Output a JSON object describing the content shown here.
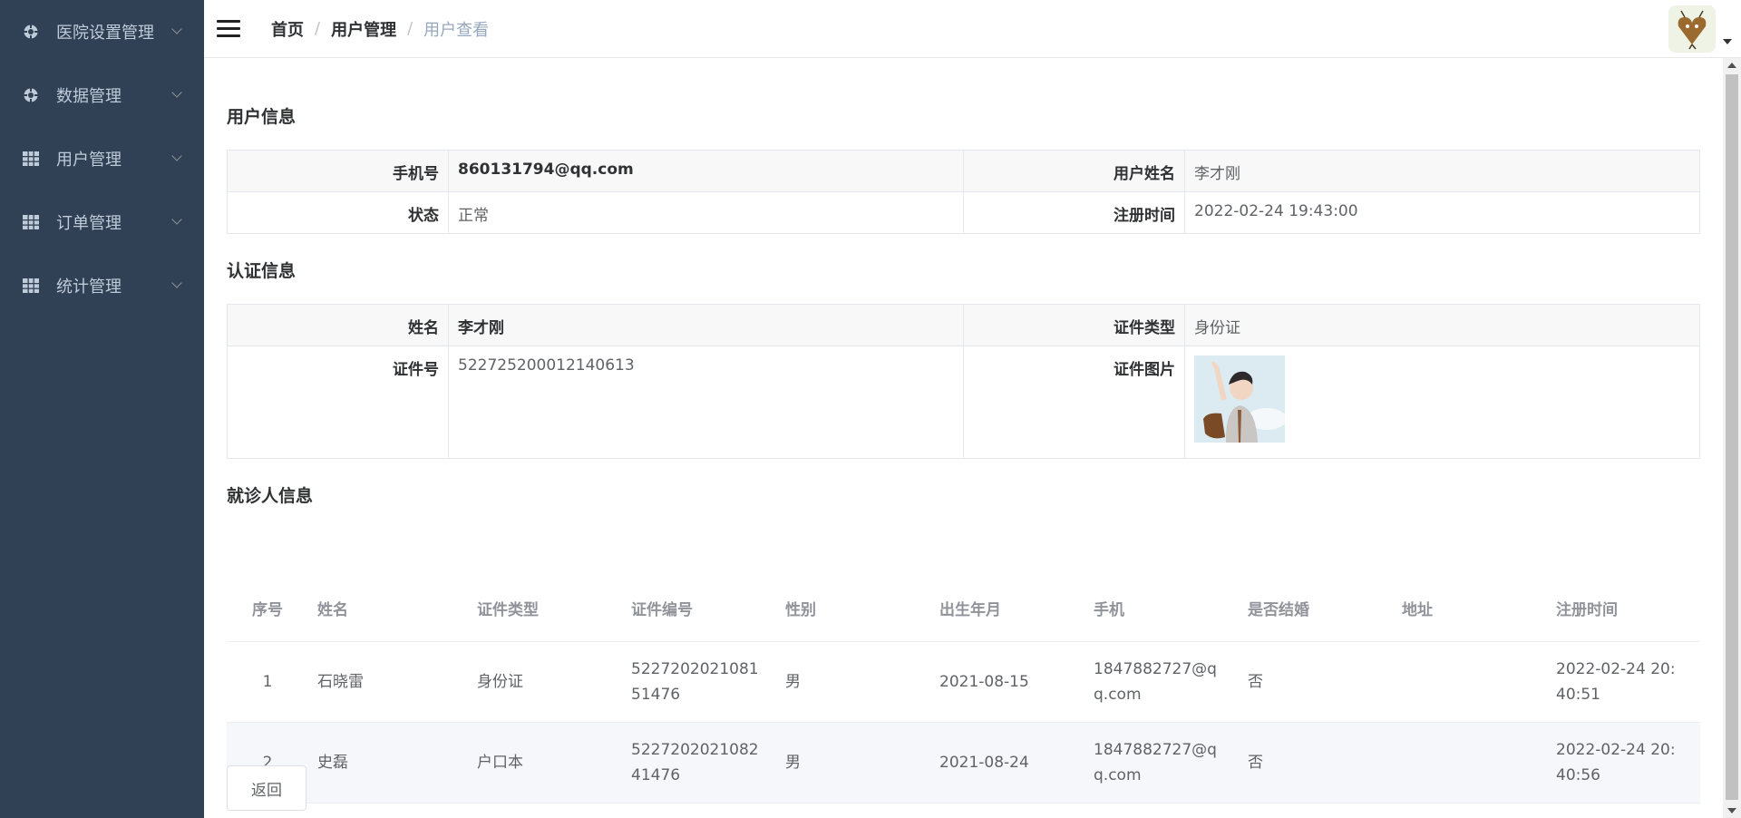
{
  "sidebar": {
    "items": [
      {
        "label": "医院设置管理",
        "icon": "gear-icon"
      },
      {
        "label": "数据管理",
        "icon": "gear-icon"
      },
      {
        "label": "用户管理",
        "icon": "grid-icon"
      },
      {
        "label": "订单管理",
        "icon": "grid-icon"
      },
      {
        "label": "统计管理",
        "icon": "grid-icon"
      }
    ]
  },
  "breadcrumb": {
    "home": "首页",
    "section": "用户管理",
    "current": "用户查看",
    "separator": "/"
  },
  "user_info": {
    "title": "用户信息",
    "phone_label": "手机号",
    "phone": "860131794@qq.com",
    "name_label": "用户姓名",
    "name": "李才刚",
    "status_label": "状态",
    "status": "正常",
    "reg_label": "注册时间",
    "reg_time": "2022-02-24 19:43:00"
  },
  "auth_info": {
    "title": "认证信息",
    "name_label": "姓名",
    "name": "李才刚",
    "cert_type_label": "证件类型",
    "cert_type": "身份证",
    "cert_no_label": "证件号",
    "cert_no": "522725200012140613",
    "cert_img_label": "证件图片"
  },
  "patients": {
    "title": "就诊人信息",
    "columns": [
      "序号",
      "姓名",
      "证件类型",
      "证件编号",
      "性别",
      "出生年月",
      "手机",
      "是否结婚",
      "地址",
      "注册时间"
    ],
    "rows": [
      {
        "idx": "1",
        "name": "石晓雷",
        "cert_type": "身份证",
        "cert_no": "522720202108151476",
        "sex": "男",
        "birth": "2021-08-15",
        "phone": "1847882727@qq.com",
        "married": "否",
        "address": "",
        "reg": "2022-02-24 20:40:51"
      },
      {
        "idx": "2",
        "name": "史磊",
        "cert_type": "户口本",
        "cert_no": "522720202108241476",
        "sex": "男",
        "birth": "2021-08-24",
        "phone": "1847882727@qq.com",
        "married": "否",
        "address": "",
        "reg": "2022-02-24 20:40:56"
      }
    ]
  },
  "actions": {
    "back": "返回"
  },
  "colors": {
    "sidebar_bg": "#304156",
    "sidebar_text": "#bfcbd9",
    "breadcrumb_current": "#97a8be",
    "stripe": "#f5f7fa"
  }
}
